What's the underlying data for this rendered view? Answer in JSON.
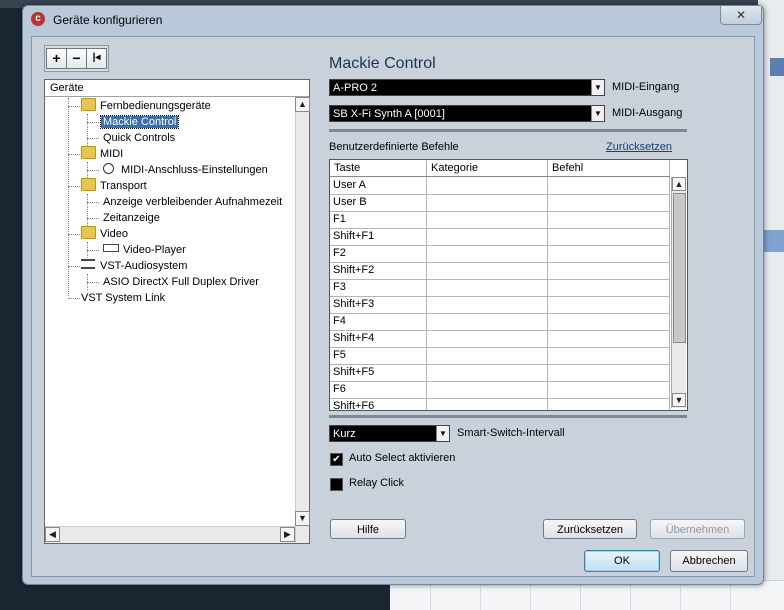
{
  "window": {
    "title": "Geräte konfigurieren",
    "close_glyph": "✕",
    "icon_glyph": "c"
  },
  "toolbar": {
    "add": "+",
    "remove": "−",
    "reset": "|◂"
  },
  "tree": {
    "header": "Geräte",
    "items": [
      {
        "label": "Fernbedienungsgeräte"
      },
      {
        "label": "Mackie Control"
      },
      {
        "label": "Quick Controls"
      },
      {
        "label": "MIDI"
      },
      {
        "label": "MIDI-Anschluss-Einstellungen"
      },
      {
        "label": "Transport"
      },
      {
        "label": "Anzeige verbleibender Aufnahmezeit"
      },
      {
        "label": "Zeitanzeige"
      },
      {
        "label": "Video"
      },
      {
        "label": "Video-Player"
      },
      {
        "label": "VST-Audiosystem"
      },
      {
        "label": "ASIO DirectX Full Duplex Driver"
      },
      {
        "label": "VST System Link"
      }
    ]
  },
  "panel": {
    "title": "Mackie Control",
    "midi_in_value": "A-PRO 2",
    "midi_in_label": "MIDI-Eingang",
    "midi_out_value": "SB X-Fi Synth A [0001]",
    "midi_out_label": "MIDI-Ausgang",
    "custom_commands_label": "Benutzerdefinierte Befehle",
    "reset_link": "Zurücksetzen",
    "columns": [
      "Taste",
      "Kategorie",
      "Befehl"
    ],
    "rows": [
      "User A",
      "User B",
      "F1",
      "Shift+F1",
      "F2",
      "Shift+F2",
      "F3",
      "Shift+F3",
      "F4",
      "Shift+F4",
      "F5",
      "Shift+F5",
      "F6",
      "Shift+F6"
    ],
    "smart_switch_value": "Kurz",
    "smart_switch_label": "Smart-Switch-Intervall",
    "auto_select_label": "Auto Select aktivieren",
    "auto_select_checked": true,
    "relay_click_label": "Relay Click",
    "relay_click_checked": false
  },
  "buttons": {
    "help": "Hilfe",
    "reset": "Zurücksetzen",
    "apply": "Übernehmen",
    "ok": "OK",
    "cancel": "Abbrechen"
  }
}
